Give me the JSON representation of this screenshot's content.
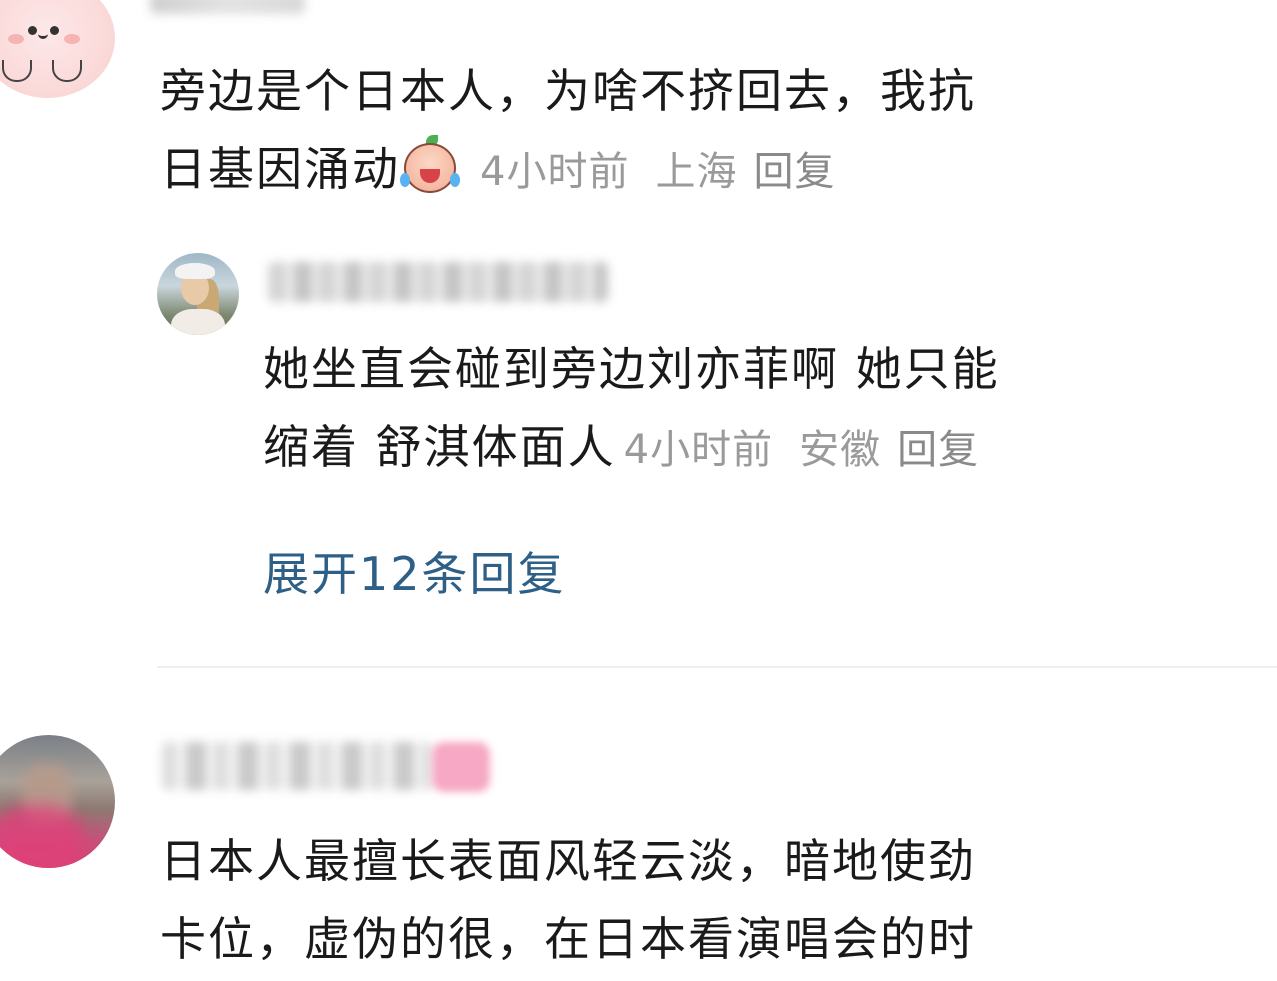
{
  "comments": [
    {
      "text_line1": "旁边是个日本人，为啥不挤回去，我抗",
      "text_line2": "日基因涌动",
      "emoji": "crying-laughing-emoji",
      "time": "4小时前",
      "location": "上海",
      "reply_label": "回复",
      "replies": [
        {
          "text_line1": "她坐直会碰到旁边刘亦菲啊 她只能",
          "text_line2": "缩着 舒淇体面人",
          "time": "4小时前",
          "location": "安徽",
          "reply_label": "回复"
        }
      ],
      "expand_label": "展开12条回复"
    },
    {
      "text_line1": "日本人最擅长表面风轻云淡，暗地使劲",
      "text_line2": "卡位，虚伪的很，在日本看演唱会的时"
    }
  ],
  "colors": {
    "text": "#1a1a1a",
    "meta": "#9a9a9a",
    "link": "#2e5f86",
    "divider": "#efefef"
  }
}
